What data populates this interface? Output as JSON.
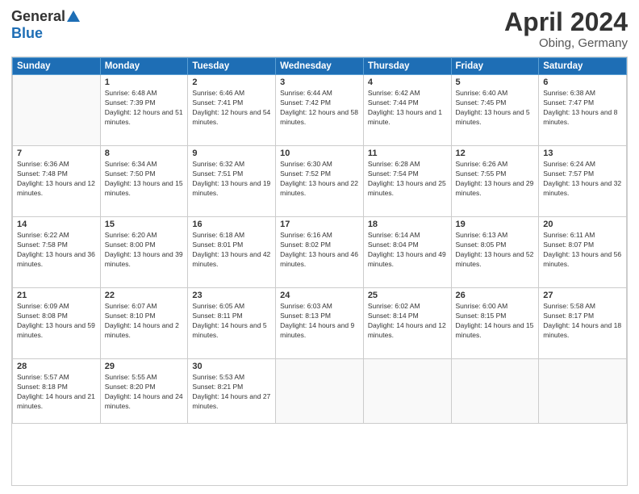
{
  "header": {
    "logo_general": "General",
    "logo_blue": "Blue",
    "month_title": "April 2024",
    "location": "Obing, Germany"
  },
  "days_of_week": [
    "Sunday",
    "Monday",
    "Tuesday",
    "Wednesday",
    "Thursday",
    "Friday",
    "Saturday"
  ],
  "weeks": [
    [
      {
        "day": "",
        "sunrise": "",
        "sunset": "",
        "daylight": "",
        "empty": true
      },
      {
        "day": "1",
        "sunrise": "Sunrise: 6:48 AM",
        "sunset": "Sunset: 7:39 PM",
        "daylight": "Daylight: 12 hours and 51 minutes.",
        "empty": false
      },
      {
        "day": "2",
        "sunrise": "Sunrise: 6:46 AM",
        "sunset": "Sunset: 7:41 PM",
        "daylight": "Daylight: 12 hours and 54 minutes.",
        "empty": false
      },
      {
        "day": "3",
        "sunrise": "Sunrise: 6:44 AM",
        "sunset": "Sunset: 7:42 PM",
        "daylight": "Daylight: 12 hours and 58 minutes.",
        "empty": false
      },
      {
        "day": "4",
        "sunrise": "Sunrise: 6:42 AM",
        "sunset": "Sunset: 7:44 PM",
        "daylight": "Daylight: 13 hours and 1 minute.",
        "empty": false
      },
      {
        "day": "5",
        "sunrise": "Sunrise: 6:40 AM",
        "sunset": "Sunset: 7:45 PM",
        "daylight": "Daylight: 13 hours and 5 minutes.",
        "empty": false
      },
      {
        "day": "6",
        "sunrise": "Sunrise: 6:38 AM",
        "sunset": "Sunset: 7:47 PM",
        "daylight": "Daylight: 13 hours and 8 minutes.",
        "empty": false
      }
    ],
    [
      {
        "day": "7",
        "sunrise": "Sunrise: 6:36 AM",
        "sunset": "Sunset: 7:48 PM",
        "daylight": "Daylight: 13 hours and 12 minutes.",
        "empty": false
      },
      {
        "day": "8",
        "sunrise": "Sunrise: 6:34 AM",
        "sunset": "Sunset: 7:50 PM",
        "daylight": "Daylight: 13 hours and 15 minutes.",
        "empty": false
      },
      {
        "day": "9",
        "sunrise": "Sunrise: 6:32 AM",
        "sunset": "Sunset: 7:51 PM",
        "daylight": "Daylight: 13 hours and 19 minutes.",
        "empty": false
      },
      {
        "day": "10",
        "sunrise": "Sunrise: 6:30 AM",
        "sunset": "Sunset: 7:52 PM",
        "daylight": "Daylight: 13 hours and 22 minutes.",
        "empty": false
      },
      {
        "day": "11",
        "sunrise": "Sunrise: 6:28 AM",
        "sunset": "Sunset: 7:54 PM",
        "daylight": "Daylight: 13 hours and 25 minutes.",
        "empty": false
      },
      {
        "day": "12",
        "sunrise": "Sunrise: 6:26 AM",
        "sunset": "Sunset: 7:55 PM",
        "daylight": "Daylight: 13 hours and 29 minutes.",
        "empty": false
      },
      {
        "day": "13",
        "sunrise": "Sunrise: 6:24 AM",
        "sunset": "Sunset: 7:57 PM",
        "daylight": "Daylight: 13 hours and 32 minutes.",
        "empty": false
      }
    ],
    [
      {
        "day": "14",
        "sunrise": "Sunrise: 6:22 AM",
        "sunset": "Sunset: 7:58 PM",
        "daylight": "Daylight: 13 hours and 36 minutes.",
        "empty": false
      },
      {
        "day": "15",
        "sunrise": "Sunrise: 6:20 AM",
        "sunset": "Sunset: 8:00 PM",
        "daylight": "Daylight: 13 hours and 39 minutes.",
        "empty": false
      },
      {
        "day": "16",
        "sunrise": "Sunrise: 6:18 AM",
        "sunset": "Sunset: 8:01 PM",
        "daylight": "Daylight: 13 hours and 42 minutes.",
        "empty": false
      },
      {
        "day": "17",
        "sunrise": "Sunrise: 6:16 AM",
        "sunset": "Sunset: 8:02 PM",
        "daylight": "Daylight: 13 hours and 46 minutes.",
        "empty": false
      },
      {
        "day": "18",
        "sunrise": "Sunrise: 6:14 AM",
        "sunset": "Sunset: 8:04 PM",
        "daylight": "Daylight: 13 hours and 49 minutes.",
        "empty": false
      },
      {
        "day": "19",
        "sunrise": "Sunrise: 6:13 AM",
        "sunset": "Sunset: 8:05 PM",
        "daylight": "Daylight: 13 hours and 52 minutes.",
        "empty": false
      },
      {
        "day": "20",
        "sunrise": "Sunrise: 6:11 AM",
        "sunset": "Sunset: 8:07 PM",
        "daylight": "Daylight: 13 hours and 56 minutes.",
        "empty": false
      }
    ],
    [
      {
        "day": "21",
        "sunrise": "Sunrise: 6:09 AM",
        "sunset": "Sunset: 8:08 PM",
        "daylight": "Daylight: 13 hours and 59 minutes.",
        "empty": false
      },
      {
        "day": "22",
        "sunrise": "Sunrise: 6:07 AM",
        "sunset": "Sunset: 8:10 PM",
        "daylight": "Daylight: 14 hours and 2 minutes.",
        "empty": false
      },
      {
        "day": "23",
        "sunrise": "Sunrise: 6:05 AM",
        "sunset": "Sunset: 8:11 PM",
        "daylight": "Daylight: 14 hours and 5 minutes.",
        "empty": false
      },
      {
        "day": "24",
        "sunrise": "Sunrise: 6:03 AM",
        "sunset": "Sunset: 8:13 PM",
        "daylight": "Daylight: 14 hours and 9 minutes.",
        "empty": false
      },
      {
        "day": "25",
        "sunrise": "Sunrise: 6:02 AM",
        "sunset": "Sunset: 8:14 PM",
        "daylight": "Daylight: 14 hours and 12 minutes.",
        "empty": false
      },
      {
        "day": "26",
        "sunrise": "Sunrise: 6:00 AM",
        "sunset": "Sunset: 8:15 PM",
        "daylight": "Daylight: 14 hours and 15 minutes.",
        "empty": false
      },
      {
        "day": "27",
        "sunrise": "Sunrise: 5:58 AM",
        "sunset": "Sunset: 8:17 PM",
        "daylight": "Daylight: 14 hours and 18 minutes.",
        "empty": false
      }
    ],
    [
      {
        "day": "28",
        "sunrise": "Sunrise: 5:57 AM",
        "sunset": "Sunset: 8:18 PM",
        "daylight": "Daylight: 14 hours and 21 minutes.",
        "empty": false
      },
      {
        "day": "29",
        "sunrise": "Sunrise: 5:55 AM",
        "sunset": "Sunset: 8:20 PM",
        "daylight": "Daylight: 14 hours and 24 minutes.",
        "empty": false
      },
      {
        "day": "30",
        "sunrise": "Sunrise: 5:53 AM",
        "sunset": "Sunset: 8:21 PM",
        "daylight": "Daylight: 14 hours and 27 minutes.",
        "empty": false
      },
      {
        "day": "",
        "sunrise": "",
        "sunset": "",
        "daylight": "",
        "empty": true
      },
      {
        "day": "",
        "sunrise": "",
        "sunset": "",
        "daylight": "",
        "empty": true
      },
      {
        "day": "",
        "sunrise": "",
        "sunset": "",
        "daylight": "",
        "empty": true
      },
      {
        "day": "",
        "sunrise": "",
        "sunset": "",
        "daylight": "",
        "empty": true
      }
    ]
  ]
}
